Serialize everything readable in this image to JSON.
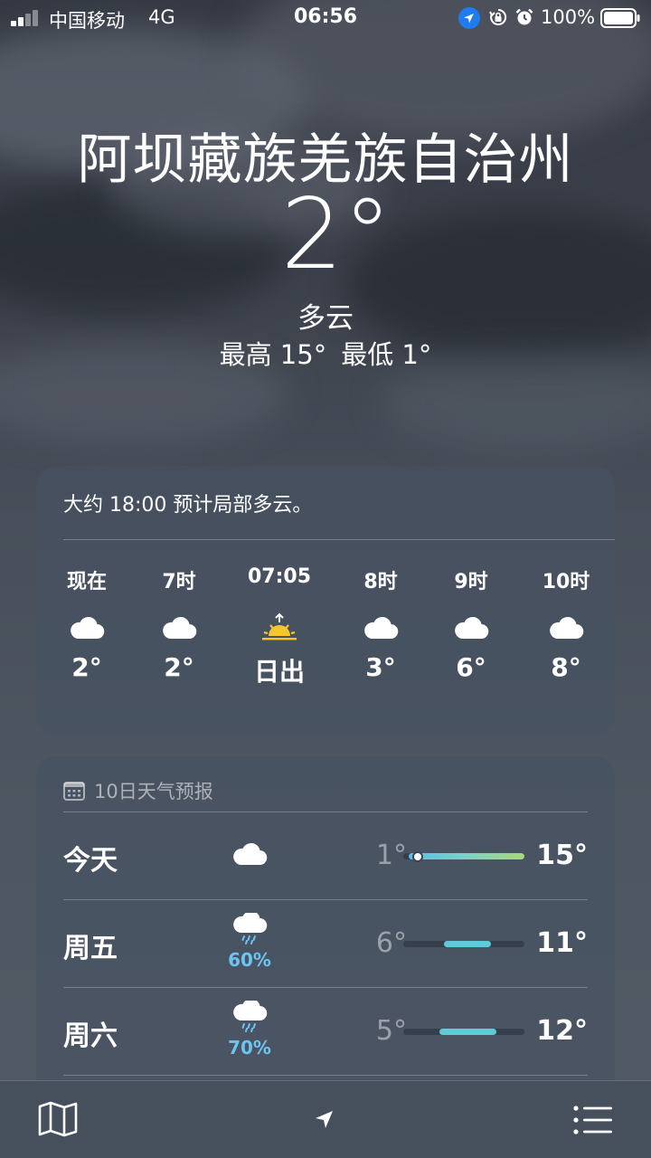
{
  "status_bar": {
    "carrier": "中国移动",
    "network": "4G",
    "time": "06:56",
    "battery": "100%"
  },
  "location": {
    "city": "阿坝藏族羌族自治州",
    "temperature": "2°",
    "condition": "多云",
    "high": "最高 15°",
    "low": "最低 1°"
  },
  "hourly": {
    "summary": "大约 18:00 预计局部多云。",
    "items": [
      {
        "label": "现在",
        "icon": "cloud-icon",
        "temp": "2°"
      },
      {
        "label": "7时",
        "icon": "cloud-icon",
        "temp": "2°"
      },
      {
        "label": "07:05",
        "icon": "sunrise-icon",
        "temp": "日出"
      },
      {
        "label": "8时",
        "icon": "cloud-icon",
        "temp": "3°"
      },
      {
        "label": "9时",
        "icon": "cloud-icon",
        "temp": "6°"
      },
      {
        "label": "10时",
        "icon": "cloud-icon",
        "temp": "8°"
      }
    ]
  },
  "daily": {
    "header": "10日天气预报",
    "days": [
      {
        "day": "今天",
        "icon": "cloud-icon",
        "pop": "",
        "low": "1°",
        "high": "15°"
      },
      {
        "day": "周五",
        "icon": "cloud-rain-icon",
        "pop": "60%",
        "low": "6°",
        "high": "11°"
      },
      {
        "day": "周六",
        "icon": "cloud-rain-icon",
        "pop": "70%",
        "low": "5°",
        "high": "12°"
      }
    ]
  },
  "colors": {
    "precipitation": "#6cc4f2",
    "location_badge": "#1e7cf0",
    "sun": "#f6c531"
  }
}
